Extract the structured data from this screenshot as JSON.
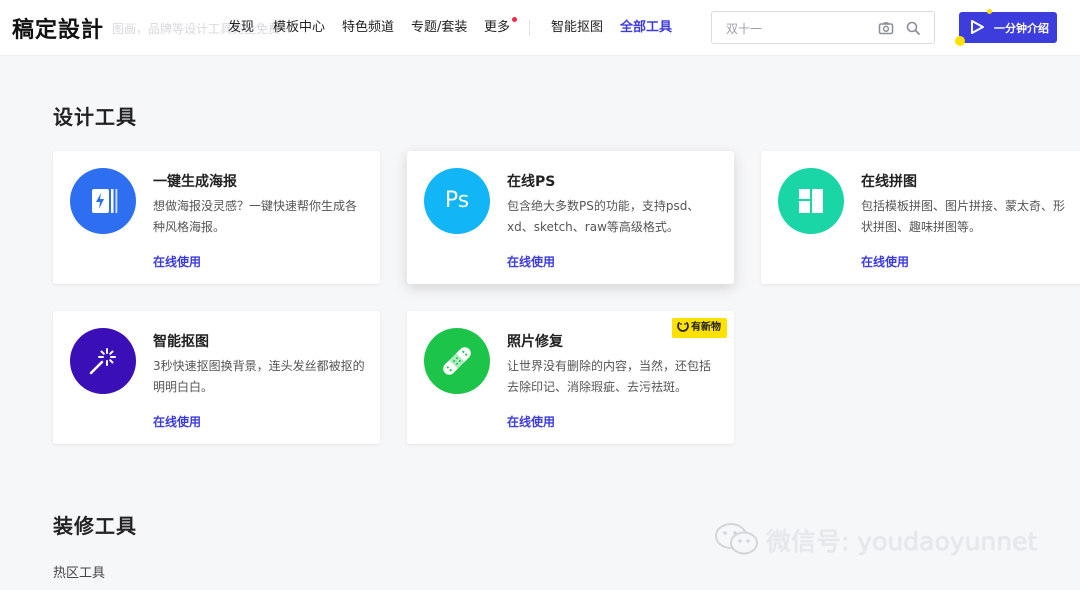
{
  "header": {
    "logo": "稿定設計",
    "faint_text": "图画，品牌等设计工具完全免费",
    "nav": [
      {
        "label": "发现"
      },
      {
        "label": "模板中心"
      },
      {
        "label": "特色频道"
      },
      {
        "label": "专题/套装"
      },
      {
        "label": "更多"
      },
      {
        "label": "智能抠图"
      },
      {
        "label": "全部工具"
      }
    ],
    "search_placeholder": "双十一",
    "intro_label": "一分钟介绍"
  },
  "design_tools": {
    "title": "设计工具",
    "cards": [
      {
        "title": "一键生成海报",
        "desc": "想做海报没灵感？一键快速帮你生成各种风格海报。",
        "link": "在线使用",
        "icon": "poster-icon",
        "color": "#2e6ff2"
      },
      {
        "title": "在线PS",
        "desc": "包含绝大多数PS的功能，支持psd、xd、sketch、raw等高级格式。",
        "link": "在线使用",
        "icon": "ps-icon",
        "icon_text": "Ps",
        "color": "#12b5f5"
      },
      {
        "title": "在线拼图",
        "desc": "包括模板拼图、图片拼接、蒙太奇、形状拼图、趣味拼图等。",
        "link": "在线使用",
        "icon": "collage-icon",
        "color": "#1ad6a6"
      },
      {
        "title": "智能抠图",
        "desc": "3秒快速抠图换背景，连头发丝都被抠的明明白白。",
        "link": "在线使用",
        "icon": "magic-wand-icon",
        "color": "#3a0fb8"
      },
      {
        "title": "照片修复",
        "desc": "让世界没有删除的内容，当然，还包括去除印记、消除瑕疵、去污祛斑。",
        "link": "在线使用",
        "icon": "bandage-icon",
        "color": "#1cc44a",
        "badge": "有新物"
      }
    ]
  },
  "decor_tools": {
    "title": "装修工具",
    "item": "热区工具"
  },
  "watermark": "微信号: youdaoyunnet"
}
